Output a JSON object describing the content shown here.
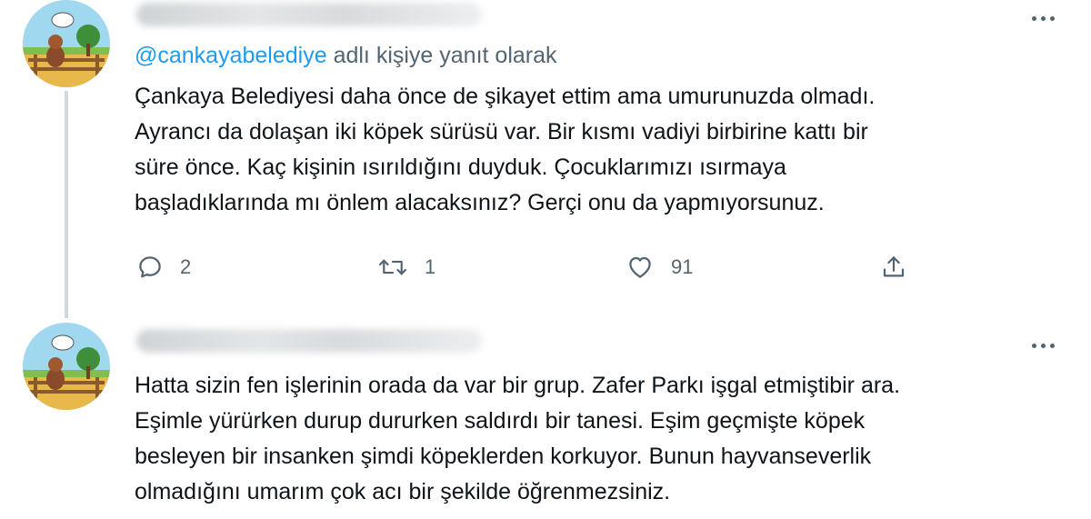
{
  "tweets": [
    {
      "reply_prefix": "@cankayabelediye",
      "reply_suffix": " adlı kişiye yanıt olarak",
      "lines": [
        "Çankaya Belediyesi daha önce de şikayet ettim ama umurunuzda olmadı.",
        "Ayrancı da dolaşan iki köpek sürüsü var. Bir kısmı vadiyi birbirine kattı bir",
        "süre önce. Kaç kişinin ısırıldığını duyduk. Çocuklarımızı ısırmaya",
        "başladıklarında mı önlem alacaksınız? Gerçi onu da yapmıyorsunuz."
      ],
      "actions": {
        "reply_count": "2",
        "retweet_count": "1",
        "like_count": "91"
      }
    },
    {
      "lines": [
        "Hatta sizin fen işlerinin orada da var bir grup. Zafer Parkı işgal etmiştibir ara.",
        "Eşimle yürürken durup dururken saldırdı bir tanesi. Eşim geçmişte köpek",
        "besleyen bir insanken şimdi köpeklerden korkuyor. Bunun hayvanseverlik",
        "olmadığını umarım çok acı bir şekilde öğrenmezsiniz."
      ]
    }
  ],
  "icons": {
    "more": "more-horizontal-icon",
    "reply": "reply-bubble-icon",
    "retweet": "retweet-icon",
    "like": "heart-icon",
    "share": "share-icon"
  },
  "colors": {
    "link": "#1d9bf0",
    "secondary_text": "#536471",
    "text": "#0f1419",
    "thread_line": "#cfd9de"
  }
}
